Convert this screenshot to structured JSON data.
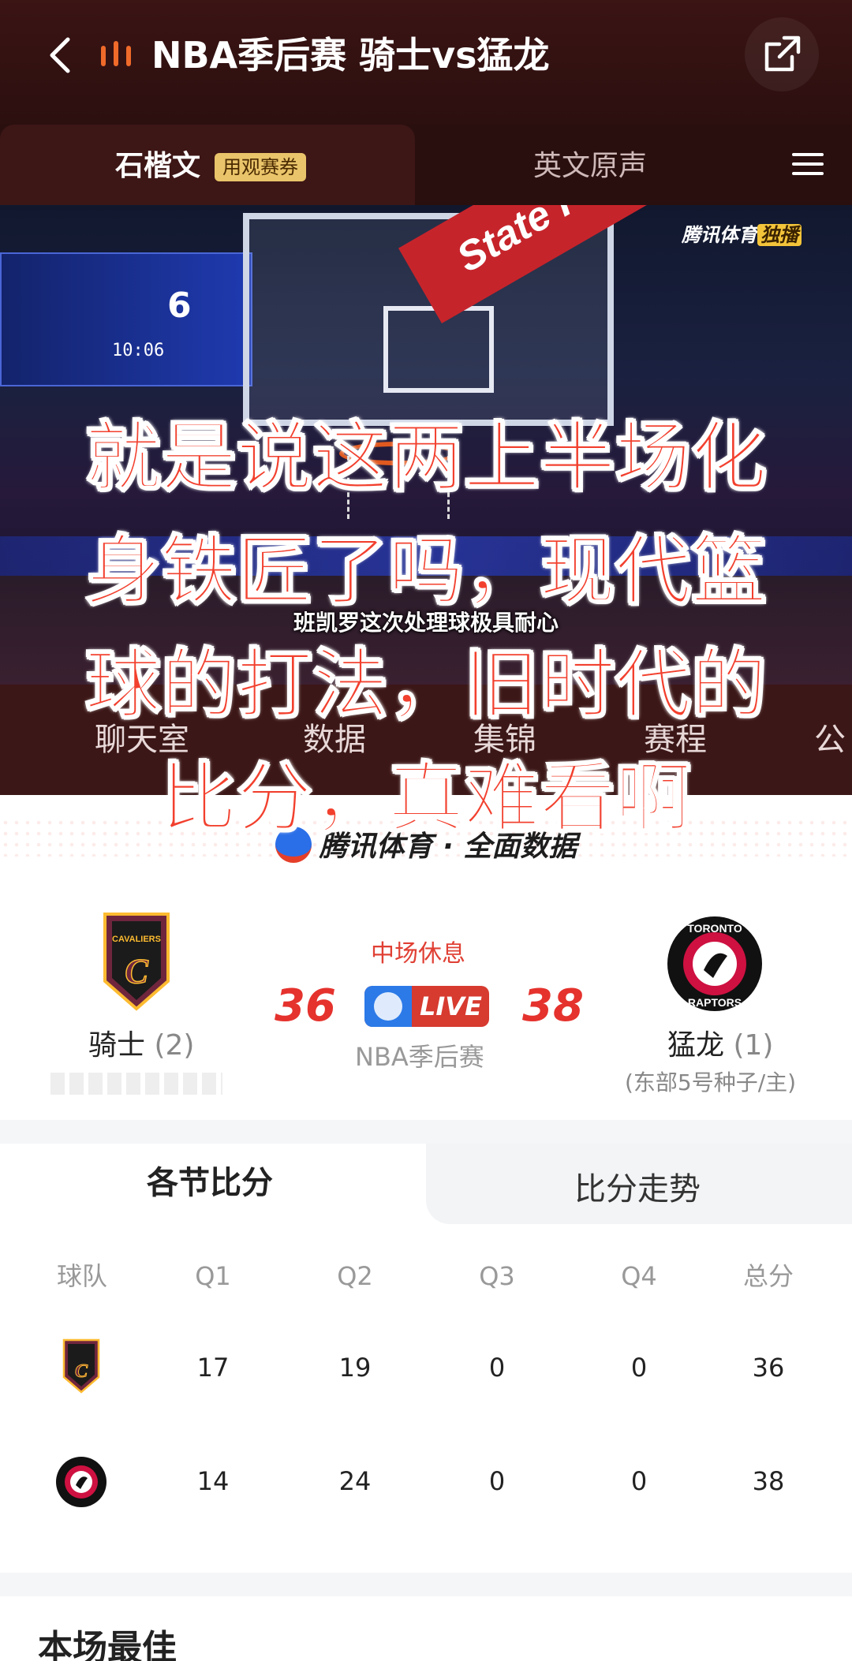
{
  "header": {
    "title": "NBA季后赛 骑士vs猛龙",
    "commentary_tabs": [
      "石楷文",
      "英文原声"
    ],
    "ticket_badge": "用观赛券"
  },
  "video": {
    "watermark_brand": "腾讯体育",
    "watermark_tag": "独播",
    "caption": "班凯罗这次处理球极具耐心",
    "scoreboard_time": "10:06",
    "scoreboard_num": "6",
    "sponsor": "State Farm"
  },
  "overlay_text": "就是说这两上半场化身铁匠了吗，现代篮球的打法，旧时代的比分，真难看啊",
  "subnav": [
    "聊天室",
    "数据",
    "集锦",
    "赛程",
    "公"
  ],
  "scorecard": {
    "brand_line": "腾讯体育 · 全面数据",
    "status": "中场休息",
    "live_label": "LIVE",
    "match_type": "NBA季后赛",
    "home": {
      "name": "骑士",
      "seed_note": "(2)",
      "score": "36"
    },
    "away": {
      "name": "猛龙",
      "seed_note": "(1)",
      "detail": "(东部5号种子/主)",
      "score": "38"
    }
  },
  "quarters": {
    "tabs": [
      "各节比分",
      "比分走势"
    ],
    "headers": [
      "球队",
      "Q1",
      "Q2",
      "Q3",
      "Q4",
      "总分"
    ],
    "rows": [
      {
        "team": "cavaliers",
        "values": [
          "17",
          "19",
          "0",
          "0",
          "36"
        ]
      },
      {
        "team": "raptors",
        "values": [
          "14",
          "24",
          "0",
          "0",
          "38"
        ]
      }
    ]
  },
  "section_title": "本场最佳",
  "colors": {
    "accent_red": "#e5322d",
    "header_bg": "#3b1414",
    "live_blue": "#2c7ae8"
  }
}
